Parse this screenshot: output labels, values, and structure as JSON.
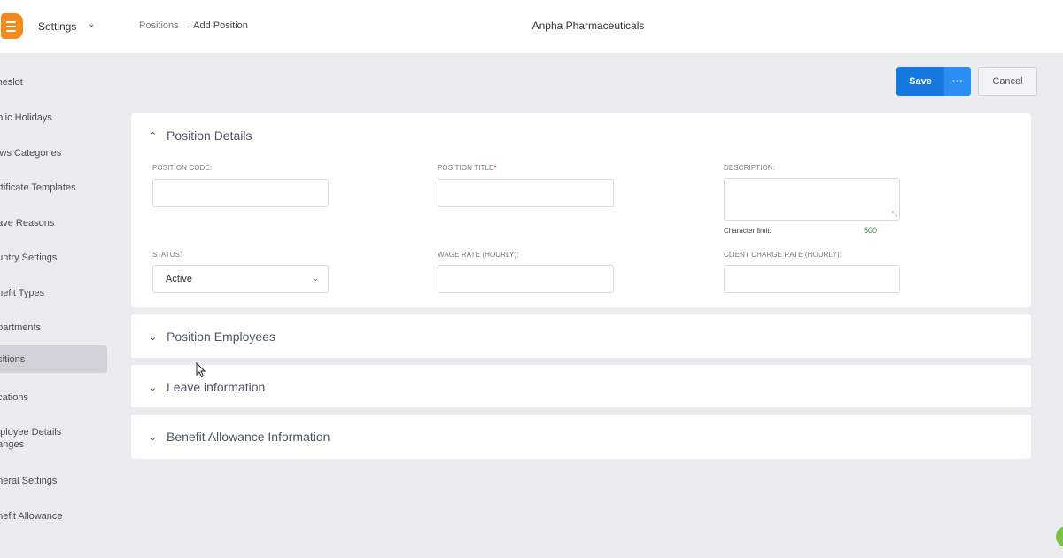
{
  "header": {
    "app_title": "Settings",
    "breadcrumb": {
      "parent": "Positions",
      "separator": "→",
      "current": "Add Position"
    },
    "company": "Anpha Pharmaceuticals"
  },
  "sidebar": {
    "items": [
      {
        "label": "imeslot"
      },
      {
        "label": "ublic Holidays"
      },
      {
        "label": "lews Categories"
      },
      {
        "label": "ertificate Templates"
      },
      {
        "label": "eave Reasons"
      },
      {
        "label": "ountry Settings"
      },
      {
        "label": "enefit Types"
      },
      {
        "label": "epartments"
      },
      {
        "label": "ositions",
        "active": true
      },
      {
        "label": "ocations"
      },
      {
        "label": "mployee Details\nhanges"
      },
      {
        "label": "eneral Settings"
      },
      {
        "label": "enefit Allowance"
      }
    ]
  },
  "actions": {
    "save": "Save",
    "more": "···",
    "cancel": "Cancel"
  },
  "position_details": {
    "title": "Position Details",
    "fields": {
      "code": {
        "label": "POSITION CODE:",
        "value": ""
      },
      "title": {
        "label": "POSITION TITLE",
        "required_mark": "*",
        "value": ""
      },
      "description": {
        "label": "DESCRIPTION:",
        "value": "",
        "char_limit_label": "Character limit:",
        "char_limit_value": "500"
      },
      "status": {
        "label": "STATUS:",
        "value": "Active"
      },
      "wage": {
        "label": "WAGE RATE (HOURLY):",
        "value": ""
      },
      "client_charge": {
        "label": "CLIENT CHARGE RATE (HOURLY):",
        "value": ""
      }
    }
  },
  "sections": [
    {
      "title": "Position Employees"
    },
    {
      "title": "Leave information"
    },
    {
      "title": "Benefit Allowance Information"
    }
  ],
  "icons": {
    "expanded": "chevron-up-icon",
    "collapsed": "chevron-down-icon",
    "accent": "#1478e0",
    "logo_color": "#f28a1e"
  }
}
